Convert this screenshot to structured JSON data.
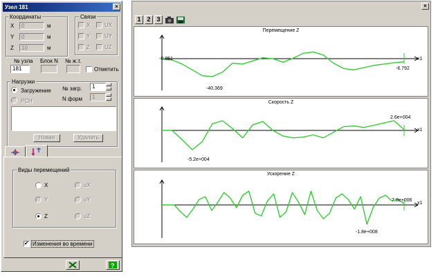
{
  "dialog": {
    "title": "Узел 181",
    "close_glyph": "×",
    "coords": {
      "caption": "Координаты",
      "rows": [
        {
          "label": "X",
          "value": "0",
          "unit": "м"
        },
        {
          "label": "Y",
          "value": "0",
          "unit": "м"
        },
        {
          "label": "Z",
          "value": "10",
          "unit": "м"
        }
      ]
    },
    "links": {
      "caption": "Связи",
      "items": [
        "X",
        "UX",
        "Y",
        "UY",
        "Z",
        "UZ"
      ]
    },
    "node_no_label": "№ узла",
    "node_no_value": "181",
    "block_label": "Блок N",
    "zt_label": "№ ж.т.",
    "mark_label": "Отметить",
    "loads": {
      "caption": "Нагрузки",
      "radio_load": "Загружение",
      "radio_rsn": "РСН",
      "load_no_label": "№ загр.",
      "load_no_value": "1",
      "form_no_label": "N форм",
      "form_no_value": "1",
      "new_button": "Новая",
      "delete_button": "Удалить"
    },
    "tabs": [
      "tab-displacement",
      "tab-time"
    ],
    "disp_types": {
      "caption": "Виды перемещений",
      "items": [
        {
          "label": "X",
          "enabled": true,
          "checked": false
        },
        {
          "label": "uX",
          "enabled": false,
          "checked": false
        },
        {
          "label": "Y",
          "enabled": false,
          "checked": false
        },
        {
          "label": "uY",
          "enabled": false,
          "checked": false
        },
        {
          "label": "Z",
          "enabled": true,
          "checked": true
        },
        {
          "label": "uZ",
          "enabled": false,
          "checked": false
        }
      ]
    },
    "time_changes_label": "Изменения во времени",
    "time_changes_checked": true
  },
  "chart_window": {
    "toolbar": [
      "1",
      "2",
      "3"
    ],
    "icons": [
      "camera-icon",
      "save-icon"
    ],
    "close_glyph": "×"
  },
  "chart_data": [
    {
      "type": "line",
      "title": "Перемещение Z",
      "xlabel": "x1",
      "annotations": [
        "-0.851",
        "-40.369",
        "-6.792"
      ],
      "color": "#33cc33",
      "x": [
        0,
        1,
        2,
        3,
        4,
        5,
        6,
        7,
        8,
        9,
        10,
        11,
        12,
        13,
        14,
        15,
        16,
        17,
        18,
        19,
        20,
        21,
        22,
        23,
        24
      ],
      "y": [
        0,
        -3,
        -12,
        -25,
        -38,
        -40,
        -30,
        -10,
        -12,
        -5,
        2,
        0,
        -8,
        1,
        12,
        15,
        8,
        -10,
        -22,
        -25,
        -20,
        -15,
        -12,
        -9,
        -7
      ]
    },
    {
      "type": "line",
      "title": "Скорость Z",
      "xlabel": "x1",
      "annotations": [
        "2.6e+004",
        "-5.2e+004"
      ],
      "color": "#33cc33",
      "x": [
        0,
        1,
        2,
        3,
        4,
        5,
        6,
        7,
        8,
        9,
        10,
        11,
        12,
        13,
        14,
        15,
        16,
        17,
        18,
        19,
        20,
        21,
        22,
        23,
        24
      ],
      "y": [
        0,
        0,
        -25000,
        -52000,
        -30000,
        18000,
        26000,
        5000,
        -20000,
        15000,
        24000,
        0,
        -15000,
        -20000,
        -18000,
        -12000,
        -20000,
        -5000,
        10000,
        12000,
        8000,
        14000,
        20000,
        26000,
        2000
      ]
    },
    {
      "type": "line",
      "title": "Ускорение Z",
      "xlabel": "x1",
      "annotations": [
        "7.8e+006",
        "-1.8e+008"
      ],
      "color": "#33cc33",
      "x": [
        0,
        1,
        2,
        3,
        4,
        5,
        6,
        7,
        8,
        9,
        10,
        11,
        12,
        13,
        14,
        15,
        16,
        17,
        18,
        19,
        20,
        21,
        22,
        23,
        24,
        25,
        26,
        27,
        28,
        29,
        30,
        31,
        32,
        33,
        34,
        35,
        36,
        37,
        38,
        39
      ],
      "y": [
        0,
        0,
        0,
        -0.5,
        -0.9,
        -0.3,
        0.4,
        0.6,
        -0.4,
        0.2,
        0.9,
        0.5,
        -0.2,
        0.7,
        1.0,
        -0.6,
        -0.8,
        0.3,
        0.8,
        -0.9,
        -0.5,
        0.9,
        0.2,
        -0.7,
        1.0,
        -0.4,
        -1.0,
        -0.6,
        0.5,
        0.8,
        0.4,
        -0.3,
        0.6,
        -1.4,
        -0.2,
        0.5,
        0.7,
        0.3,
        0.4,
        0.1
      ]
    }
  ]
}
